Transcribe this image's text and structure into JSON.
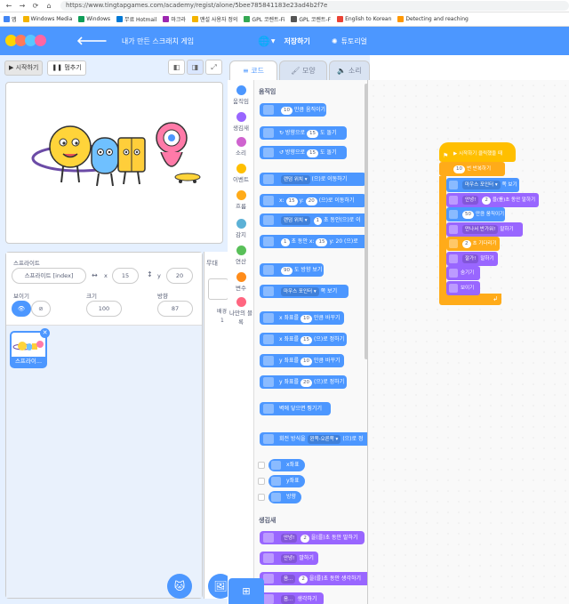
{
  "browser": {
    "url": "https://www.tingtapgames.com/academy/regist/alone/5bee785841183e23ad4b2f7e",
    "nav_back": "←",
    "nav_forward": "→",
    "nav_reload": "⟳",
    "nav_home": "⌂",
    "bookmarks": [
      {
        "label": "앱",
        "color": "#4285f4"
      },
      {
        "label": "Windows Media",
        "color": "#f4b400"
      },
      {
        "label": "Windows",
        "color": "#0f9d58"
      },
      {
        "label": "무료 Hotmail",
        "color": "#0078d4"
      },
      {
        "label": "마크라",
        "color": "#9c27b0"
      },
      {
        "label": "맨설 사용자 정의",
        "color": "#f4b400"
      },
      {
        "label": "GPL 코렌트-Fi",
        "color": "#34a853"
      },
      {
        "label": "GPL 코렌트-F",
        "color": "#555555"
      },
      {
        "label": "English to Korean",
        "color": "#ea4335"
      },
      {
        "label": "Detecting and reaching",
        "color": "#ff9800"
      }
    ]
  },
  "header": {
    "back_label": "🡐",
    "project_title": "내가 만든 스크래치 게임",
    "globe_icon": "🌐",
    "save_label": "저장하기",
    "tutorial_label": "튜토리얼"
  },
  "stage_controls": {
    "start_label": "▶ 시작하기",
    "stop_label": "❚❚ 멈추기"
  },
  "sprite_info": {
    "sprite_label": "스프라이트",
    "sprite_name": "스프라이트 [index]",
    "x_label": "x",
    "x_value": "15",
    "y_label": "y",
    "y_value": "20",
    "show_label": "보이기",
    "size_label": "크기",
    "size_value": "100",
    "direction_label": "방향",
    "direction_value": "87"
  },
  "sprite_list": {
    "thumb_label": "스프라이...",
    "stage_title": "무대",
    "backdrop_label": "배경",
    "backdrop_count": "1"
  },
  "tabs": [
    {
      "label": "코드"
    },
    {
      "label": "모양"
    },
    {
      "label": "소리"
    }
  ],
  "categories": [
    {
      "label": "움직임",
      "color": "#4c97ff"
    },
    {
      "label": "생김새",
      "color": "#9966ff"
    },
    {
      "label": "소리",
      "color": "#cf63cf"
    },
    {
      "label": "이벤트",
      "color": "#ffbf00"
    },
    {
      "label": "흐름",
      "color": "#ffab19"
    },
    {
      "label": "감지",
      "color": "#5cb1d6"
    },
    {
      "label": "연산",
      "color": "#59c059"
    },
    {
      "label": "변수",
      "color": "#ff8c1a"
    },
    {
      "label": "나만의 블록",
      "color": "#ff6680"
    }
  ],
  "palette": {
    "motion_title": "움직임",
    "looks_title": "생김새",
    "motion_blocks": [
      {
        "pre": "",
        "val": "10",
        "post": "만큼 움직이기"
      },
      {
        "pre": "↻ 방향으로",
        "val": "15",
        "post": "도 돌기"
      },
      {
        "pre": "↺ 방향으로",
        "val": "15",
        "post": "도 돌기"
      },
      {
        "pre": "",
        "dd": "랜덤 위치 ▾",
        "post": "(으)로 이동하기"
      },
      {
        "pre": "x:",
        "val": "15",
        "mid": "y:",
        "val2": "20",
        "post": "(으)로 이동하기"
      },
      {
        "pre": "",
        "val": "1",
        "mid": "초 동안",
        "dd": "랜덤 위치 ▾",
        "post": "(으)로 이"
      },
      {
        "pre": "",
        "val": "1",
        "mid": "초 동안 x:",
        "val2": "15",
        "post": "y: 20 (으)로"
      },
      {
        "pre": "",
        "val": "90",
        "post": "도 방향 보기"
      },
      {
        "pre": "",
        "dd": "마우스 포인터 ▾",
        "post": "쪽 보기"
      },
      {
        "pre": "x 좌표를",
        "val": "10",
        "post": "만큼 바꾸기"
      },
      {
        "pre": "x 좌표를",
        "val": "15",
        "post": "(으)로 정하기"
      },
      {
        "pre": "y 좌표를",
        "val": "10",
        "post": "만큼 바꾸기"
      },
      {
        "pre": "y 좌표를",
        "val": "20",
        "post": "(으)로 정하기"
      },
      {
        "pre": "벽에 닿으면 튕기기",
        "post": ""
      },
      {
        "pre": "회전 방식을",
        "dd": "왼쪽-오른쪽 ▾",
        "post": "(으)로 정"
      }
    ],
    "reporters": [
      "x좌표",
      "y좌표",
      "방향"
    ],
    "looks_blocks": [
      {
        "pre": "",
        "dd": "안녕!",
        "post": "을(를)",
        "val": "2",
        "post2": "초 동안 말하기"
      },
      {
        "pre": "",
        "dd": "안녕!",
        "post": "말하기"
      },
      {
        "pre": "",
        "dd": "음...",
        "post": "을(를)",
        "val": "2",
        "post2": "초 동안 생각하기"
      },
      {
        "pre": "",
        "dd": "음...",
        "post": "생각하기"
      }
    ]
  },
  "script": {
    "hat": "▶ 시작하기 클릭했을 때",
    "loop_val": "10",
    "loop_label": "번 반복하기",
    "loop_end": "↲",
    "blocks": [
      {
        "type": "motion",
        "pre": "",
        "dd": "마우스 포인터 ▾",
        "post": "쪽 보기"
      },
      {
        "type": "looks",
        "pre": "",
        "dd": "안녕!",
        "post": "을(를)",
        "val": "2",
        "post2": "초 동안 말하기"
      },
      {
        "type": "motion",
        "pre": "",
        "val": "50",
        "post": "만큼 움직이기"
      },
      {
        "type": "looks",
        "pre": "",
        "dd": "만나서 반가워!",
        "post": "말하기"
      },
      {
        "type": "ctrl",
        "pre": "",
        "val": "2",
        "post": "초 기다리기"
      },
      {
        "type": "looks",
        "pre": "",
        "dd": "잘가!",
        "post": "말하기"
      },
      {
        "type": "looks",
        "pre": "숨기기",
        "post": ""
      },
      {
        "type": "looks",
        "pre": "보이기",
        "post": ""
      }
    ]
  }
}
